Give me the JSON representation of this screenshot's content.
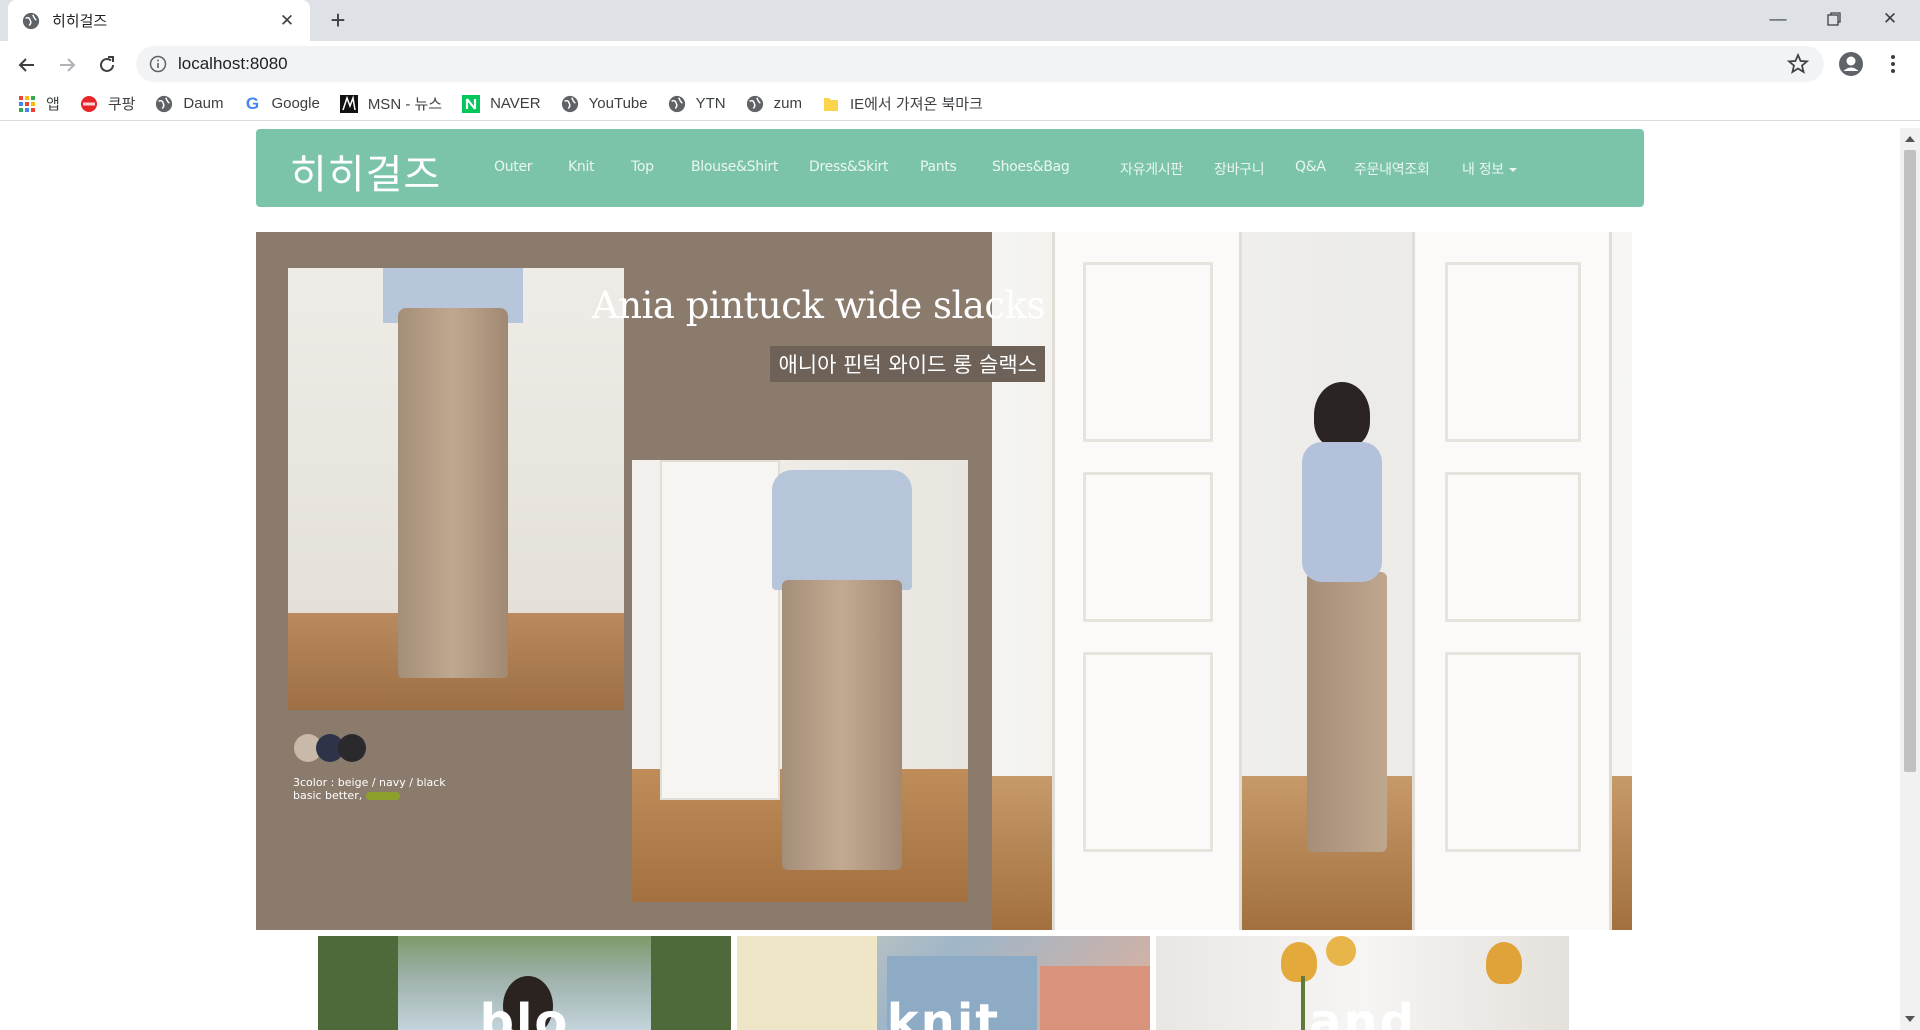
{
  "browser": {
    "tab_title": "히히걸즈",
    "url": "localhost:8080",
    "bookmarks": [
      {
        "label": "앱",
        "icon": "apps-grid-icon"
      },
      {
        "label": "쿠팡",
        "icon": "coupang-icon"
      },
      {
        "label": "Daum",
        "icon": "globe-icon"
      },
      {
        "label": "Google",
        "icon": "google-icon"
      },
      {
        "label": "MSN - 뉴스",
        "icon": "msn-icon"
      },
      {
        "label": "NAVER",
        "icon": "naver-icon"
      },
      {
        "label": "YouTube",
        "icon": "globe-icon"
      },
      {
        "label": "YTN",
        "icon": "globe-icon"
      },
      {
        "label": "zum",
        "icon": "globe-icon"
      },
      {
        "label": "IE에서 가져온 북마크",
        "icon": "folder-icon"
      }
    ]
  },
  "site": {
    "brand": "히히걸즈",
    "categories": [
      "Outer",
      "Knit",
      "Top",
      "Blouse&Shirt",
      "Dress&Skirt",
      "Pants",
      "Shoes&Bag"
    ],
    "menu": [
      "자유게시판",
      "장바구니",
      "Q&A",
      "주문내역조회",
      "내 정보"
    ],
    "accent_color": "#7bc4aa"
  },
  "hero": {
    "title": "Ania pintuck wide slacks",
    "subtitle": "애니아 핀턱 와이드 롱 슬랙스",
    "color_note_line1": "3color : beige / navy / black",
    "color_note_line2": "basic better,",
    "swatch_colors": [
      "#c8b9a8",
      "#2e3348",
      "#2a2a2c"
    ]
  },
  "cards": [
    {
      "label": "blo",
      "bg": "nature-photo"
    },
    {
      "label": "knit",
      "bg": "sweater-photo"
    },
    {
      "label": "and",
      "bg": "tulip-photo"
    }
  ]
}
